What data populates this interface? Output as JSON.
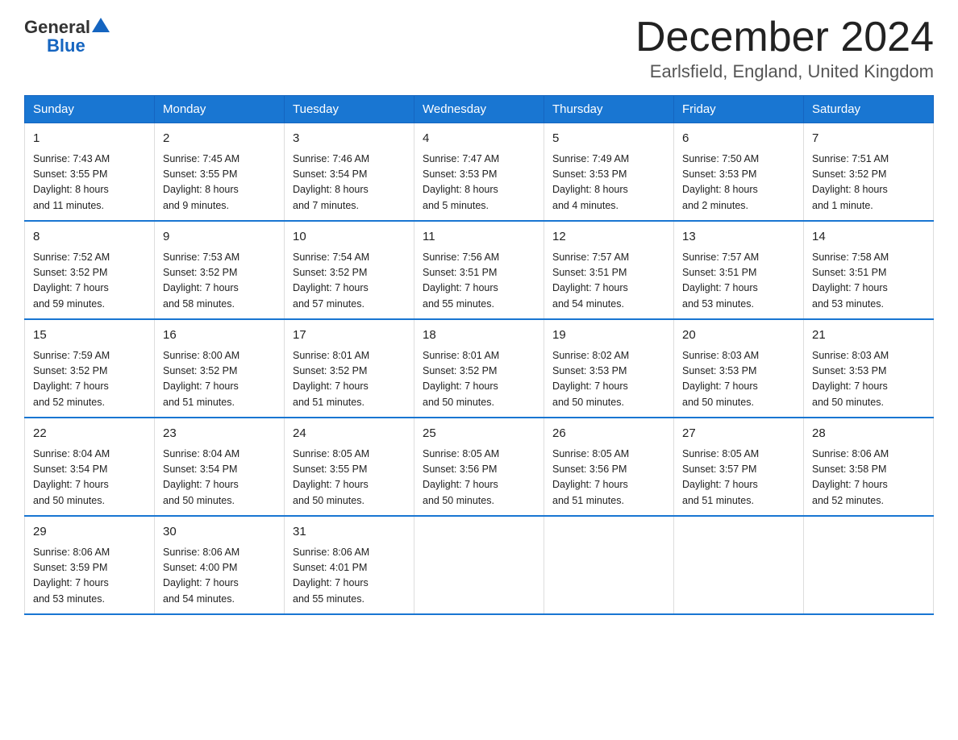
{
  "header": {
    "logo_general": "General",
    "logo_blue": "Blue",
    "month_title": "December 2024",
    "location": "Earlsfield, England, United Kingdom"
  },
  "weekdays": [
    "Sunday",
    "Monday",
    "Tuesday",
    "Wednesday",
    "Thursday",
    "Friday",
    "Saturday"
  ],
  "weeks": [
    [
      {
        "day": "1",
        "sunrise": "7:43 AM",
        "sunset": "3:55 PM",
        "daylight": "8 hours and 11 minutes."
      },
      {
        "day": "2",
        "sunrise": "7:45 AM",
        "sunset": "3:55 PM",
        "daylight": "8 hours and 9 minutes."
      },
      {
        "day": "3",
        "sunrise": "7:46 AM",
        "sunset": "3:54 PM",
        "daylight": "8 hours and 7 minutes."
      },
      {
        "day": "4",
        "sunrise": "7:47 AM",
        "sunset": "3:53 PM",
        "daylight": "8 hours and 5 minutes."
      },
      {
        "day": "5",
        "sunrise": "7:49 AM",
        "sunset": "3:53 PM",
        "daylight": "8 hours and 4 minutes."
      },
      {
        "day": "6",
        "sunrise": "7:50 AM",
        "sunset": "3:53 PM",
        "daylight": "8 hours and 2 minutes."
      },
      {
        "day": "7",
        "sunrise": "7:51 AM",
        "sunset": "3:52 PM",
        "daylight": "8 hours and 1 minute."
      }
    ],
    [
      {
        "day": "8",
        "sunrise": "7:52 AM",
        "sunset": "3:52 PM",
        "daylight": "7 hours and 59 minutes."
      },
      {
        "day": "9",
        "sunrise": "7:53 AM",
        "sunset": "3:52 PM",
        "daylight": "7 hours and 58 minutes."
      },
      {
        "day": "10",
        "sunrise": "7:54 AM",
        "sunset": "3:52 PM",
        "daylight": "7 hours and 57 minutes."
      },
      {
        "day": "11",
        "sunrise": "7:56 AM",
        "sunset": "3:51 PM",
        "daylight": "7 hours and 55 minutes."
      },
      {
        "day": "12",
        "sunrise": "7:57 AM",
        "sunset": "3:51 PM",
        "daylight": "7 hours and 54 minutes."
      },
      {
        "day": "13",
        "sunrise": "7:57 AM",
        "sunset": "3:51 PM",
        "daylight": "7 hours and 53 minutes."
      },
      {
        "day": "14",
        "sunrise": "7:58 AM",
        "sunset": "3:51 PM",
        "daylight": "7 hours and 53 minutes."
      }
    ],
    [
      {
        "day": "15",
        "sunrise": "7:59 AM",
        "sunset": "3:52 PM",
        "daylight": "7 hours and 52 minutes."
      },
      {
        "day": "16",
        "sunrise": "8:00 AM",
        "sunset": "3:52 PM",
        "daylight": "7 hours and 51 minutes."
      },
      {
        "day": "17",
        "sunrise": "8:01 AM",
        "sunset": "3:52 PM",
        "daylight": "7 hours and 51 minutes."
      },
      {
        "day": "18",
        "sunrise": "8:01 AM",
        "sunset": "3:52 PM",
        "daylight": "7 hours and 50 minutes."
      },
      {
        "day": "19",
        "sunrise": "8:02 AM",
        "sunset": "3:53 PM",
        "daylight": "7 hours and 50 minutes."
      },
      {
        "day": "20",
        "sunrise": "8:03 AM",
        "sunset": "3:53 PM",
        "daylight": "7 hours and 50 minutes."
      },
      {
        "day": "21",
        "sunrise": "8:03 AM",
        "sunset": "3:53 PM",
        "daylight": "7 hours and 50 minutes."
      }
    ],
    [
      {
        "day": "22",
        "sunrise": "8:04 AM",
        "sunset": "3:54 PM",
        "daylight": "7 hours and 50 minutes."
      },
      {
        "day": "23",
        "sunrise": "8:04 AM",
        "sunset": "3:54 PM",
        "daylight": "7 hours and 50 minutes."
      },
      {
        "day": "24",
        "sunrise": "8:05 AM",
        "sunset": "3:55 PM",
        "daylight": "7 hours and 50 minutes."
      },
      {
        "day": "25",
        "sunrise": "8:05 AM",
        "sunset": "3:56 PM",
        "daylight": "7 hours and 50 minutes."
      },
      {
        "day": "26",
        "sunrise": "8:05 AM",
        "sunset": "3:56 PM",
        "daylight": "7 hours and 51 minutes."
      },
      {
        "day": "27",
        "sunrise": "8:05 AM",
        "sunset": "3:57 PM",
        "daylight": "7 hours and 51 minutes."
      },
      {
        "day": "28",
        "sunrise": "8:06 AM",
        "sunset": "3:58 PM",
        "daylight": "7 hours and 52 minutes."
      }
    ],
    [
      {
        "day": "29",
        "sunrise": "8:06 AM",
        "sunset": "3:59 PM",
        "daylight": "7 hours and 53 minutes."
      },
      {
        "day": "30",
        "sunrise": "8:06 AM",
        "sunset": "4:00 PM",
        "daylight": "7 hours and 54 minutes."
      },
      {
        "day": "31",
        "sunrise": "8:06 AM",
        "sunset": "4:01 PM",
        "daylight": "7 hours and 55 minutes."
      },
      null,
      null,
      null,
      null
    ]
  ]
}
